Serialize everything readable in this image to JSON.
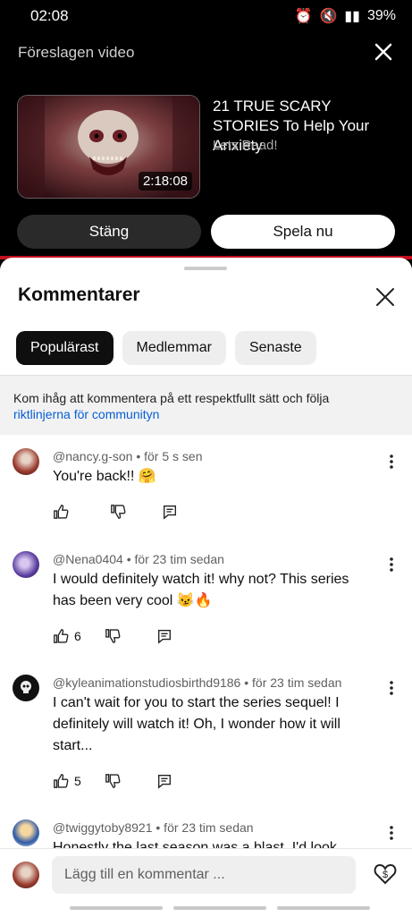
{
  "status": {
    "time": "02:08",
    "battery": "39%"
  },
  "suggested": {
    "label": "Föreslagen video",
    "title": "21 TRUE SCARY STORIES To Help Your Anxiety",
    "channel": "Lets Read!",
    "duration": "2:18:08",
    "close_label": "Stäng",
    "play_label": "Spela nu"
  },
  "comments_panel": {
    "title": "Kommentarer",
    "chips": [
      "Populärast",
      "Medlemmar",
      "Senaste"
    ],
    "notice_text": "Kom ihåg att kommentera på ett respektfullt sätt och följa",
    "notice_link": "riktlinjerna för communityn"
  },
  "comments": [
    {
      "author": "@nancy.g-son • för 5 s sen",
      "text": "You're back!! 🤗",
      "likes": ""
    },
    {
      "author": "@Nena0404 • för 23 tim sedan",
      "text": "I would definitely watch it! why not? This series has been very cool 😼🔥",
      "likes": "6"
    },
    {
      "author": "@kyleanimationstudiosbirthd9186 • för 23 tim sedan",
      "text": "I can't wait for you to start the series sequel! I definitely will watch it! Oh, I wonder how it will start...",
      "likes": "5"
    },
    {
      "author": "@twiggytoby8921 • för 23 tim sedan",
      "text": "Honestly the last season was a blast, I'd look"
    }
  ],
  "input": {
    "placeholder": "Lägg till en kommentar ..."
  }
}
